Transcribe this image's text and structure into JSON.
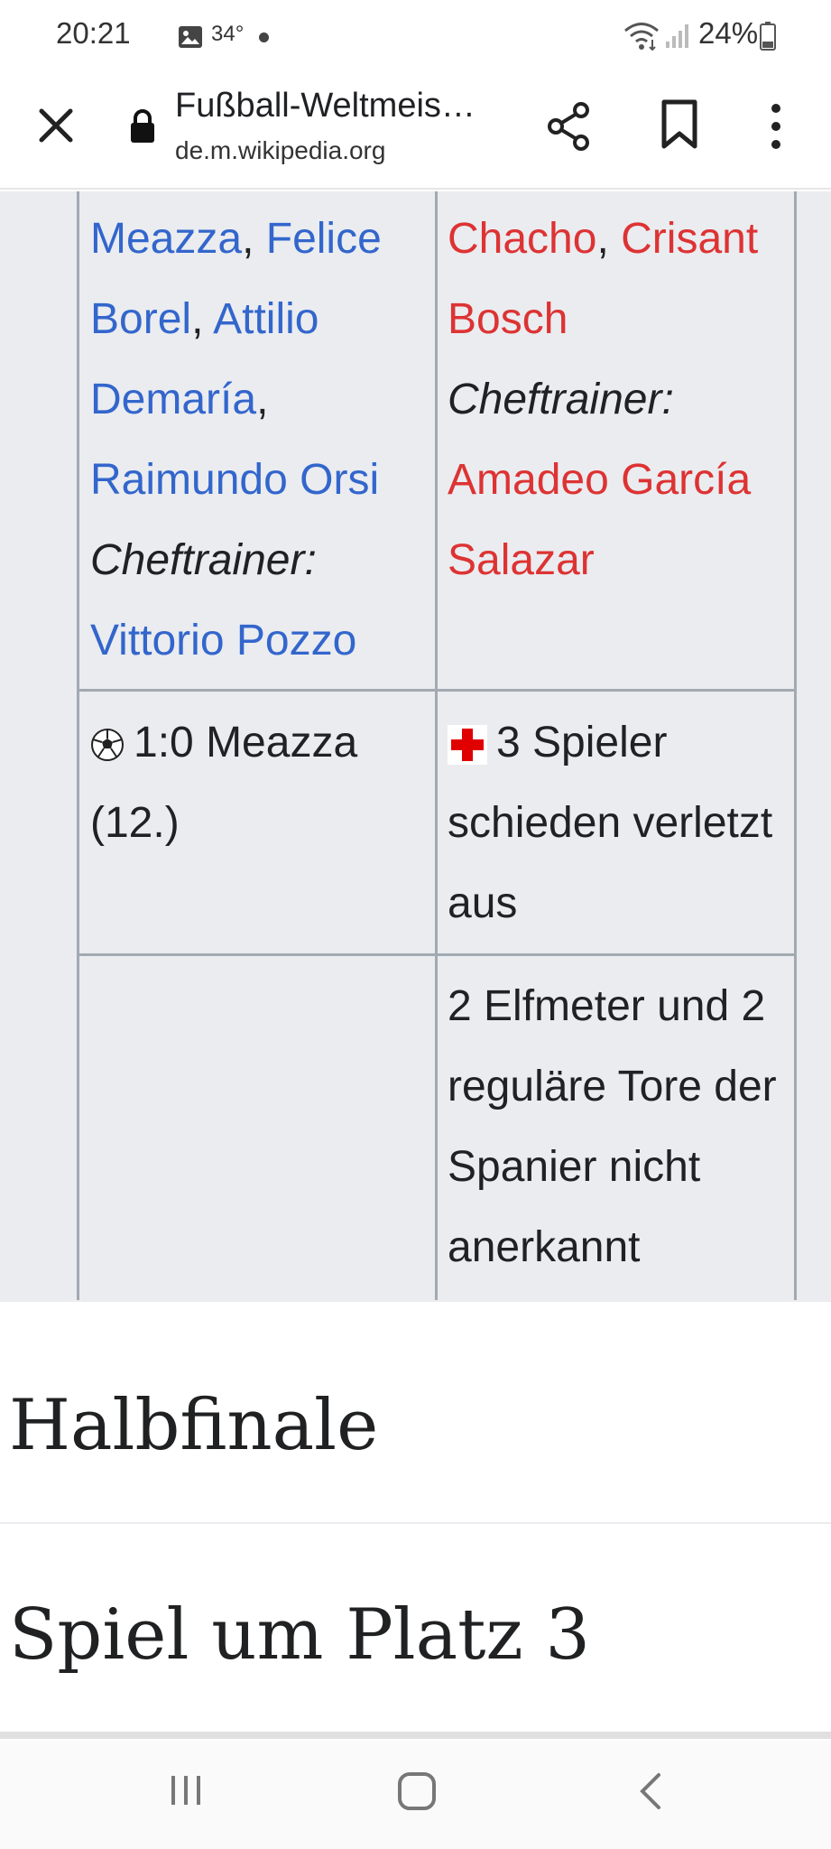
{
  "status_bar": {
    "time": "20:21",
    "temperature": "34°",
    "battery": "24%"
  },
  "browser": {
    "page_title": "Fußball-Weltmeis…",
    "url": "de.m.wikipedia.org"
  },
  "table": {
    "lineup_left": {
      "links": [
        "Meazza",
        "Felice Borel",
        "Attilio Demaría",
        "Raimundo Orsi"
      ],
      "coach_label": "Cheftrainer:",
      "coach": "Vittorio Pozzo"
    },
    "lineup_right": {
      "links": [
        "Chacho",
        "Crisant Bosch"
      ],
      "coach_label": "Cheftrainer:",
      "coach": "Amadeo García Salazar"
    },
    "goal_event": "1:0 Meazza (12.)",
    "injury_event": "3 Spieler schieden verletzt aus",
    "note": "2 Elfmeter und 2 reguläre Tore der Spanier nicht anerkannt"
  },
  "sections": {
    "halbfinale": "Halbfinale",
    "spiel_um_platz_3": "Spiel um Platz 3"
  },
  "colors": {
    "link_blue": "#3366cc",
    "link_red": "#dd3333",
    "table_bg": "#eaecf0",
    "table_border": "#a2a9b1"
  },
  "icons": {
    "goal": "soccer-ball-icon",
    "injury": "red-cross-icon"
  }
}
